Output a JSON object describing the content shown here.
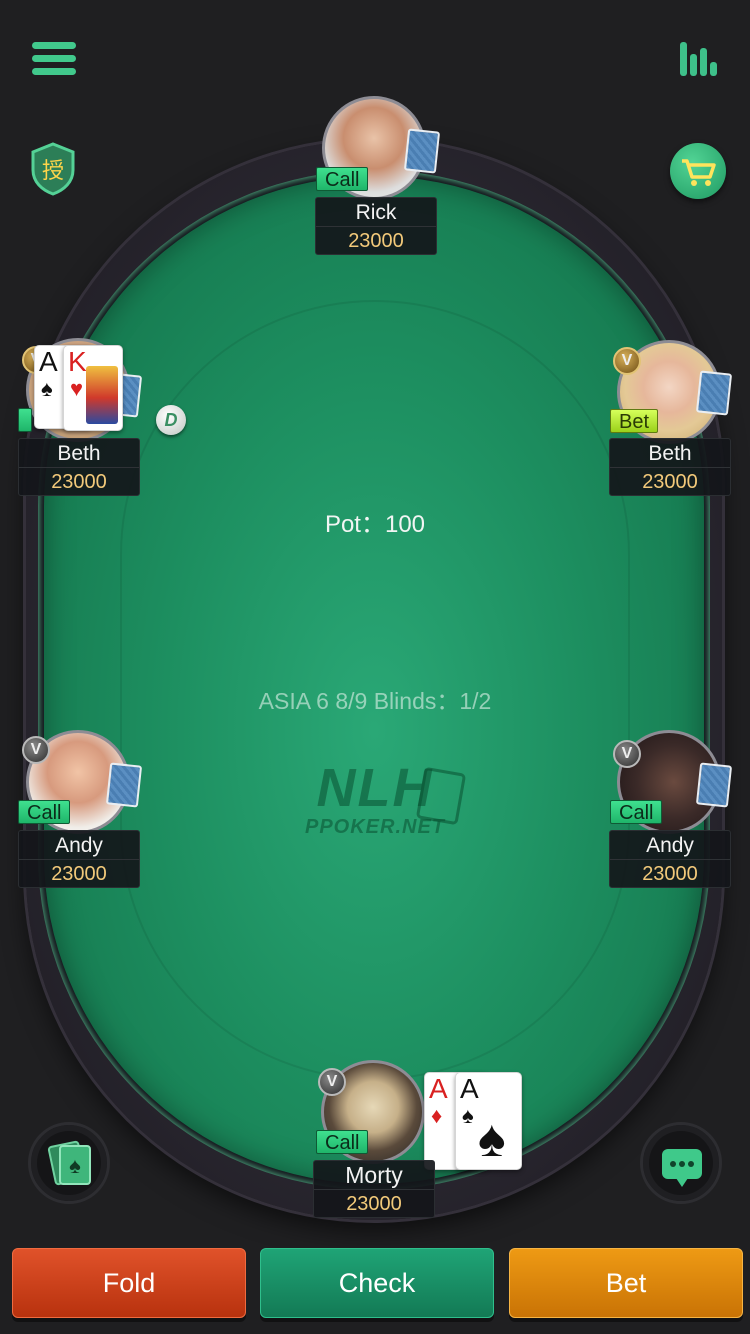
{
  "table": {
    "pot_label": "Pot：100",
    "game_info": "ASIA 6 8/9  Blinds：1/2",
    "watermark_main": "NLH",
    "watermark_sub": "PPOKER.NET",
    "dealer_label": "D"
  },
  "top_bar": {
    "badge_label": "授"
  },
  "seats": [
    {
      "name": "Rick",
      "chips": "23000",
      "action": "Call"
    },
    {
      "name": "Beth",
      "chips": "23000",
      "action": "Call",
      "cards": [
        {
          "rank": "A",
          "suit": "♠"
        },
        {
          "rank": "K",
          "suit": "♥"
        }
      ]
    },
    {
      "name": "Beth",
      "chips": "23000",
      "action": "Bet"
    },
    {
      "name": "Andy",
      "chips": "23000",
      "action": "Call"
    },
    {
      "name": "Andy",
      "chips": "23000",
      "action": "Call"
    },
    {
      "name": "Morty",
      "chips": "23000",
      "action": "Call",
      "cards": [
        {
          "rank": "A",
          "suit": "♦"
        },
        {
          "rank": "A",
          "suit": "♠"
        }
      ]
    }
  ],
  "vip_badge": "V",
  "actions": {
    "fold": "Fold",
    "check": "Check",
    "bet": "Bet"
  },
  "colors": {
    "felt": "#1d8f60",
    "fold": "#c9401a",
    "check": "#178b62",
    "bet": "#dc8710",
    "chips_text": "#f2c97a"
  }
}
